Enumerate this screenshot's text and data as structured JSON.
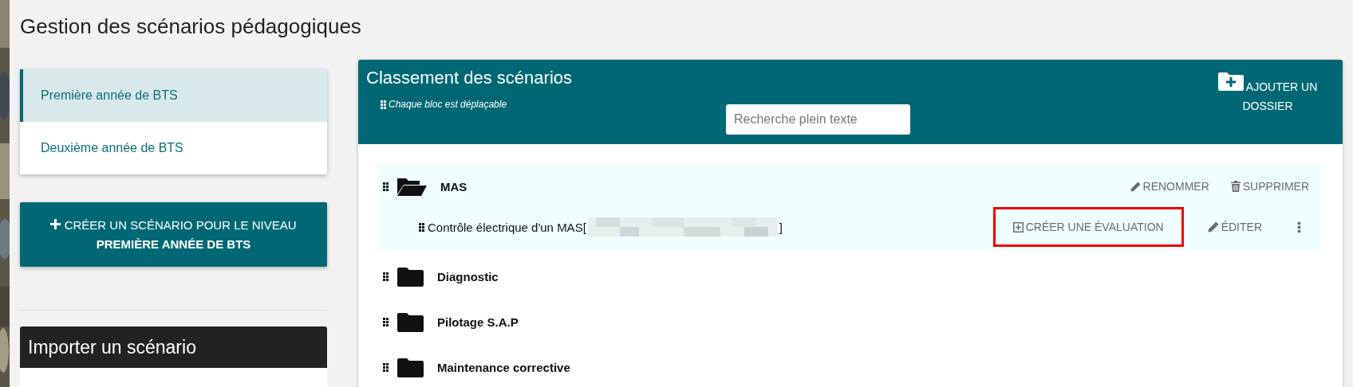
{
  "page": {
    "title": "Gestion des scénarios pédagogiques"
  },
  "levels": [
    {
      "label": "Première année de BTS",
      "selected": true
    },
    {
      "label": "Deuxième année de BTS",
      "selected": false
    }
  ],
  "create_button": {
    "line_1": "CRÉER UN SCÉNARIO POUR LE NIVEAU",
    "line_2": "PREMIÈRE ANNÉE DE BTS"
  },
  "import_panel": {
    "title": "Importer un scénario"
  },
  "ranking_panel": {
    "title": "Classement des scénarios",
    "hint": "Chaque bloc est déplaçable",
    "search": {
      "placeholder": "Recherche plein texte"
    },
    "add_folder_button": "AJOUTER UN DOSSIER",
    "folders": [
      {
        "name": "MAS",
        "expanded": true,
        "actions": [
          {
            "kind": "rename",
            "label": "RENOMMER"
          },
          {
            "kind": "delete",
            "label": "SUPPRIMER"
          }
        ],
        "scenarios": [
          {
            "title": "Contrôle électrique d'un MAS[",
            "redacted": true,
            "title_end": "]",
            "actions": [
              {
                "kind": "create",
                "label": "CRÉER UNE ÉVALUATION",
                "highlighted": true
              },
              {
                "kind": "edit",
                "label": "ÉDITER"
              },
              {
                "kind": "more"
              }
            ]
          }
        ]
      },
      {
        "name": "Diagnostic",
        "expanded": false
      },
      {
        "name": "Pilotage S.A.P",
        "expanded": false
      },
      {
        "name": "Maintenance corrective",
        "expanded": false
      }
    ]
  }
}
